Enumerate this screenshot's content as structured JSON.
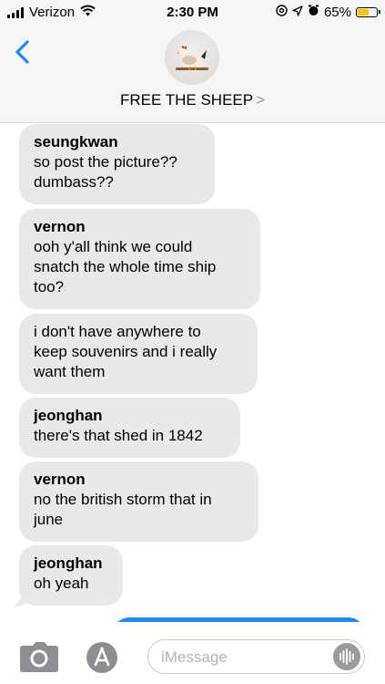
{
  "status_bar": {
    "carrier": "Verizon",
    "time": "2:30 PM",
    "battery": "65%",
    "battery_level": 0.65,
    "battery_color": "#f5c400",
    "icons": [
      "signal-icon",
      "wifi-icon",
      "at-icon",
      "location-icon",
      "alarm-icon",
      "battery-icon"
    ]
  },
  "header": {
    "back_icon": "chevron-left-icon",
    "avatar": "chicken-avatar",
    "title": "FREE THE SHEEP",
    "title_chevron": ">"
  },
  "messages": [
    {
      "sender": "seungkwan",
      "text": "so post the picture??\ndumbass??"
    },
    {
      "sender": "vernon",
      "text": "ooh y'all think we could\nsnatch the whole time ship\ntoo?"
    },
    {
      "sender": "",
      "text": "i don't have anywhere to\nkeep souvenirs and i really\nwant them"
    },
    {
      "sender": "jeonghan",
      "text": "there's that shed in 1842"
    },
    {
      "sender": "vernon",
      "text": "no the british storm that in\njune"
    },
    {
      "sender": "jeonghan",
      "text": "oh yeah"
    }
  ],
  "input_bar": {
    "camera_icon": "camera-icon",
    "apps_icon": "app-store-icon",
    "placeholder": "iMessage",
    "audio_icon": "audio-waveform-icon"
  },
  "colors": {
    "received_bubble": "#e9e9eb",
    "sent_bubble": "#1f87ff",
    "accent": "#1f87ff",
    "icon_gray": "#9a9a9f"
  }
}
